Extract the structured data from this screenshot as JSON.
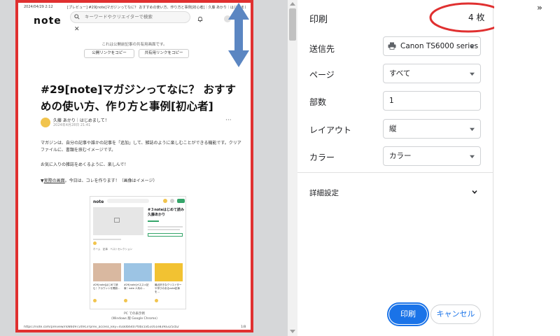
{
  "preview": {
    "header_date": "2024/04/29 2:12",
    "header_title": "[プレビュー] #29[note]マガジンってなに？ おすすめの使い方、作り方と事例[初心者]｜久藤 あかり｜はじめまして！",
    "logo": "note",
    "search_placeholder": "キーワードやクリエイターで検索",
    "close_symbol": "✕",
    "shared_note": "これは公開前記事の共有用画面です。",
    "copy_public_label": "公開リンクをコピー",
    "copy_share_label": "共有用リンクをコピー",
    "article_title": "#29[note]マガジンってなに？ おすすめの使い方、作り方と事例[初心者]",
    "author_name": "久藤 あかり｜はじめまして！",
    "author_date": "2024年4月28日 21:41",
    "more_symbol": "···",
    "body_1": "マガジンは、自分の記事や誰かの記事を「追加」して、雑誌のように楽しむことができる機能です。クリアファイルに、書類を挟むイメージです。",
    "body_2": "お気に入りの雑誌をめくるように、楽しんで！",
    "body_3_prefix": "▼",
    "body_3_link": "実際の画面",
    "body_3_suffix": "。今日は、コレを作ります！（画像はイメージ）",
    "embed": {
      "logo": "note",
      "title": "#３noteはじめて読み 久藤あかり",
      "tabs": "ホーム　記事　ベストセレクション",
      "card_1": "#29[note]はじめて読む！アカウントを開設…",
      "card_2": "#29[note]オススメ記事！note 人気の…",
      "card_3": "最近好きなクリエイターや学びのあるnote記事を…",
      "caption_line_1": "PC での表示例",
      "caption_line_2": "（Windows 版 Google Chrome）"
    },
    "footer_url": "https://note.com/preview/n086097249c3?prev_access_key=d3a0b6407f0bc1853c61e839a325cb2",
    "footer_page": "1/8"
  },
  "settings": {
    "title": "印刷",
    "sheet_count": "4 枚",
    "destination_label": "送信先",
    "destination_value": "Canon TS6000 series",
    "pages_label": "ページ",
    "pages_value": "すべて",
    "copies_label": "部数",
    "copies_value": "1",
    "layout_label": "レイアウト",
    "layout_value": "縦",
    "color_label": "カラー",
    "color_value": "カラー",
    "more_settings": "詳細設定",
    "print_button": "印刷",
    "cancel_button": "キャンセル"
  },
  "collapse_symbol": "»",
  "colors": {
    "annotation_red": "#e03030",
    "annotation_blue": "#5b86c2",
    "accent": "#1a73e8"
  },
  "icons": [
    "search-icon",
    "bell-icon",
    "printer-icon",
    "chevron-down-icon",
    "double-arrow-icon"
  ]
}
